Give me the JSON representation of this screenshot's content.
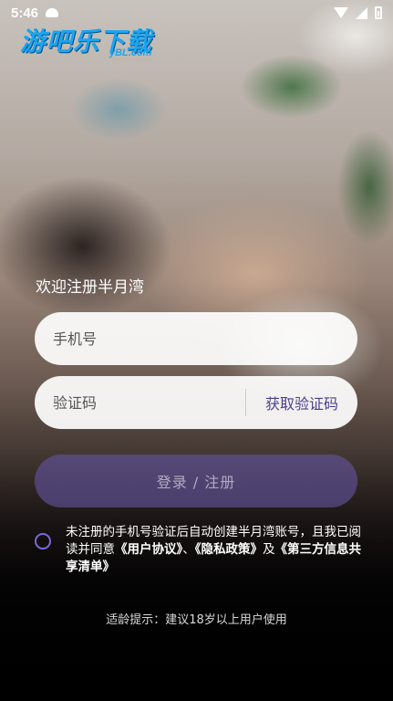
{
  "status_bar": {
    "time": "5:46"
  },
  "watermark": {
    "logo": "游吧乐下载",
    "domain": "yBL.com"
  },
  "welcome": "欢迎注册半月湾",
  "phone_field": {
    "placeholder": "手机号"
  },
  "code_field": {
    "placeholder": "验证码",
    "get_code": "获取验证码"
  },
  "login_button": "登录 / 注册",
  "agreement": {
    "prefix": "未注册的手机号验证后自动创建半月湾账号，且我已阅读并同意",
    "user_agreement": "《用户协议》",
    "sep1": "、",
    "privacy_policy": "《隐私政策》",
    "sep2": "及",
    "third_party": "《第三方信息共享清单》"
  },
  "age_tip": "适龄提示：建议18岁以上用户使用",
  "colors": {
    "accent": "#4a3f8c",
    "button": "#6254a0",
    "watermark": "#1aa6f0"
  }
}
